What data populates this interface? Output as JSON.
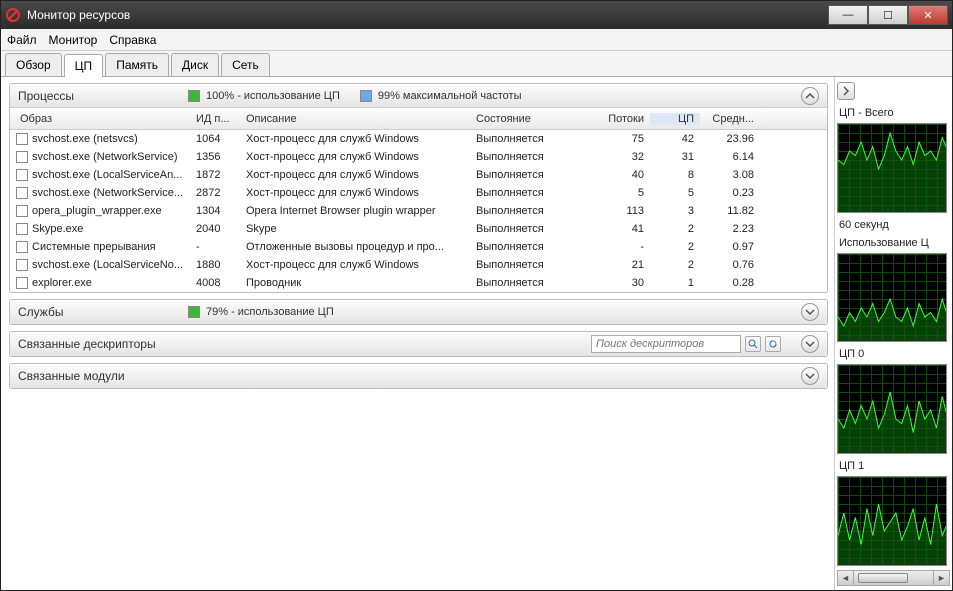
{
  "window": {
    "title": "Монитор ресурсов"
  },
  "menu": {
    "file": "Файл",
    "monitor": "Монитор",
    "help": "Справка"
  },
  "tabs": {
    "overview": "Обзор",
    "cpu": "ЦП",
    "memory": "Память",
    "disk": "Диск",
    "network": "Сеть"
  },
  "processesPanel": {
    "title": "Процессы",
    "cpuUsage": "100% - использование ЦП",
    "maxFreq": "99% максимальной частоты"
  },
  "columns": {
    "image": "Образ",
    "pid": "ИД п...",
    "desc": "Описание",
    "state": "Состояние",
    "threads": "Потоки",
    "cpu": "ЦП",
    "avg": "Средн..."
  },
  "rows": [
    {
      "img": "svchost.exe (netsvcs)",
      "pid": "1064",
      "desc": "Хост-процесс для служб Windows",
      "state": "Выполняется",
      "thr": "75",
      "cpu": "42",
      "avg": "23.96"
    },
    {
      "img": "svchost.exe (NetworkService)",
      "pid": "1356",
      "desc": "Хост-процесс для служб Windows",
      "state": "Выполняется",
      "thr": "32",
      "cpu": "31",
      "avg": "6.14"
    },
    {
      "img": "svchost.exe (LocalServiceAn...",
      "pid": "1872",
      "desc": "Хост-процесс для служб Windows",
      "state": "Выполняется",
      "thr": "40",
      "cpu": "8",
      "avg": "3.08"
    },
    {
      "img": "svchost.exe (NetworkService...",
      "pid": "2872",
      "desc": "Хост-процесс для служб Windows",
      "state": "Выполняется",
      "thr": "5",
      "cpu": "5",
      "avg": "0.23"
    },
    {
      "img": "opera_plugin_wrapper.exe",
      "pid": "1304",
      "desc": "Opera Internet Browser plugin wrapper",
      "state": "Выполняется",
      "thr": "113",
      "cpu": "3",
      "avg": "11.82"
    },
    {
      "img": "Skype.exe",
      "pid": "2040",
      "desc": "Skype",
      "state": "Выполняется",
      "thr": "41",
      "cpu": "2",
      "avg": "2.23"
    },
    {
      "img": "Системные прерывания",
      "pid": "-",
      "desc": "Отложенные вызовы процедур и про...",
      "state": "Выполняется",
      "thr": "-",
      "cpu": "2",
      "avg": "0.97"
    },
    {
      "img": "svchost.exe (LocalServiceNo...",
      "pid": "1880",
      "desc": "Хост-процесс для служб Windows",
      "state": "Выполняется",
      "thr": "21",
      "cpu": "2",
      "avg": "0.76"
    },
    {
      "img": "explorer.exe",
      "pid": "4008",
      "desc": "Проводник",
      "state": "Выполняется",
      "thr": "30",
      "cpu": "1",
      "avg": "0.28"
    }
  ],
  "servicesPanel": {
    "title": "Службы",
    "cpuUsage": "79% - использование ЦП"
  },
  "handlesPanel": {
    "title": "Связанные дескрипторы",
    "searchPlaceholder": "Поиск дескрипторов"
  },
  "modulesPanel": {
    "title": "Связанные модули"
  },
  "side": {
    "g1": "ЦП - Всего",
    "t60": "60 секунд",
    "g2": "Использование Ц",
    "g3": "ЦП 0",
    "g4": "ЦП 1"
  },
  "chart_data": [
    {
      "type": "area",
      "title": "ЦП - Всего",
      "ylim": [
        0,
        100
      ],
      "xlabel": "60 секунд",
      "values": [
        60,
        55,
        70,
        65,
        80,
        60,
        75,
        50,
        65,
        90,
        70,
        60,
        75,
        55,
        80,
        65,
        70,
        60,
        85,
        70
      ]
    },
    {
      "type": "area",
      "title": "Использование ЦП",
      "ylim": [
        0,
        100
      ],
      "values": [
        30,
        20,
        35,
        25,
        40,
        30,
        45,
        25,
        35,
        50,
        30,
        25,
        40,
        20,
        45,
        30,
        35,
        25,
        50,
        30
      ]
    },
    {
      "type": "area",
      "title": "ЦП 0",
      "ylim": [
        0,
        100
      ],
      "values": [
        40,
        30,
        50,
        35,
        55,
        40,
        60,
        30,
        45,
        70,
        40,
        35,
        55,
        25,
        60,
        40,
        50,
        30,
        65,
        40
      ]
    },
    {
      "type": "area",
      "title": "ЦП 1",
      "ylim": [
        0,
        100
      ],
      "values": [
        35,
        60,
        30,
        55,
        25,
        65,
        35,
        70,
        40,
        50,
        60,
        30,
        45,
        65,
        30,
        55,
        25,
        70,
        35,
        50
      ]
    }
  ]
}
